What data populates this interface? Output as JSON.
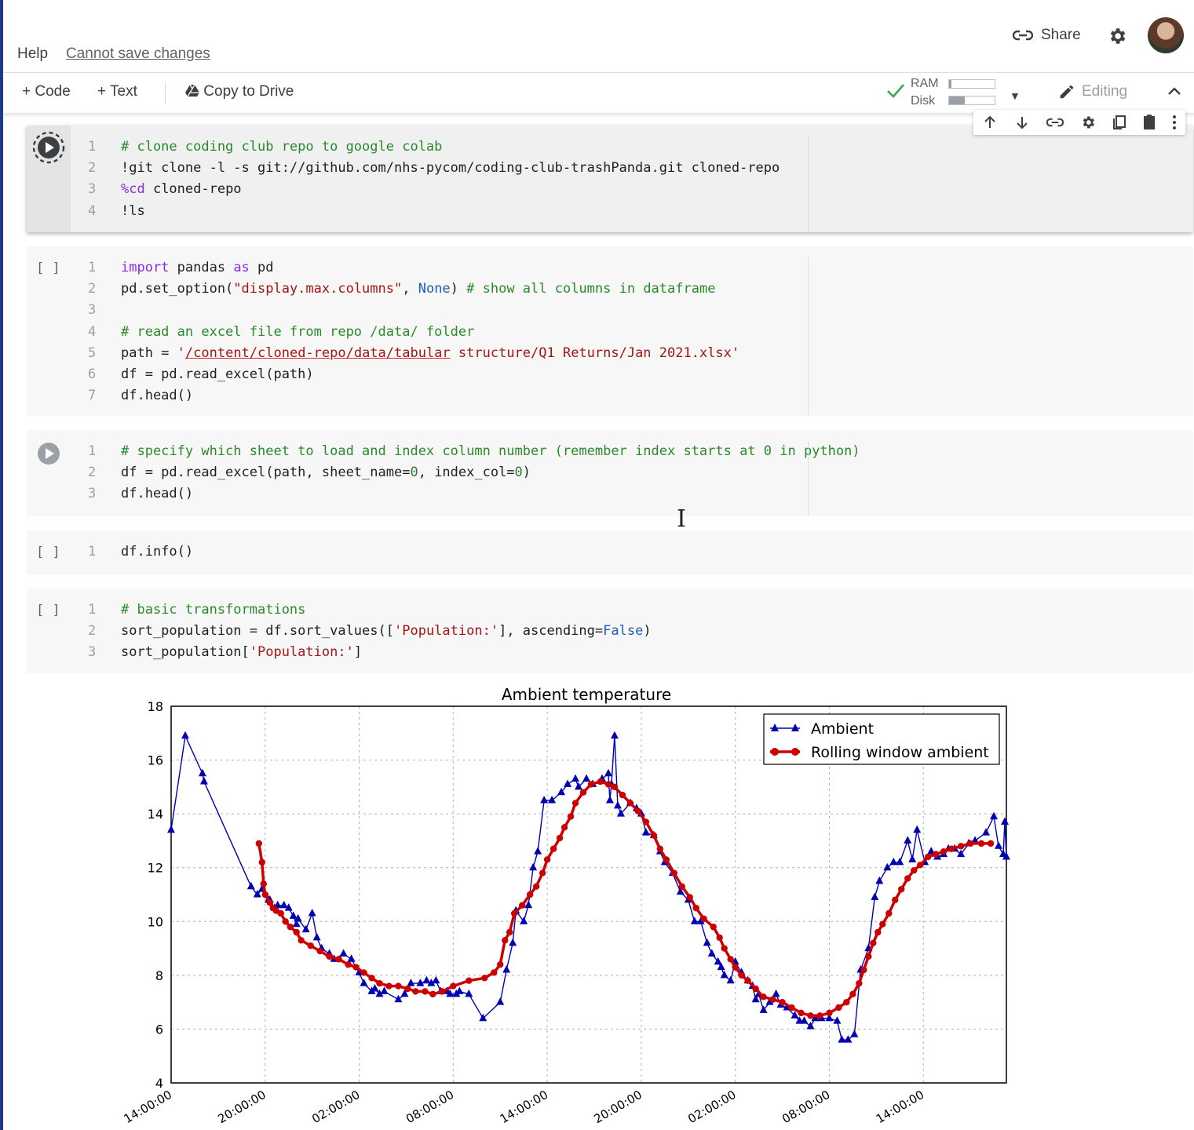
{
  "menu": {
    "help": "Help",
    "save_status": "Cannot save changes"
  },
  "header": {
    "share_label": "Share"
  },
  "toolbar": {
    "code_label": "Code",
    "text_label": "Text",
    "copy_label": "Copy to Drive",
    "ram_label": "RAM",
    "disk_label": "Disk",
    "ram_usage": 0.05,
    "disk_usage": 0.35,
    "editing_label": "Editing"
  },
  "cell_toolbar": {
    "icons": [
      "arrow-up-icon",
      "arrow-down-icon",
      "link-icon",
      "gear-icon",
      "mirror-cell-icon",
      "delete-icon",
      "more-icon"
    ]
  },
  "cells": [
    {
      "run_state": "running",
      "lines": [
        [
          [
            "cm",
            "# clone coding club repo to google colab"
          ]
        ],
        [
          [
            "pl",
            "!git clone -l -s git://github.com/nhs-pycom/coding-club-trashPanda.git cloned-repo"
          ]
        ],
        [
          [
            "mg",
            "%cd"
          ],
          [
            "pl",
            " cloned-repo"
          ]
        ],
        [
          [
            "pl",
            "!ls"
          ]
        ]
      ]
    },
    {
      "run_state": "idle",
      "bracket": "[ ]",
      "lines": [
        [
          [
            "kw",
            "import"
          ],
          [
            "pl",
            " pandas "
          ],
          [
            "kw",
            "as"
          ],
          [
            "pl",
            " pd"
          ]
        ],
        [
          [
            "pl",
            "pd.set_option("
          ],
          [
            "st",
            "\"display.max.columns\""
          ],
          [
            "pl",
            ", "
          ],
          [
            "bi",
            "None"
          ],
          [
            "pl",
            ") "
          ],
          [
            "cm",
            "# show all columns in dataframe"
          ]
        ],
        [
          [
            "pl",
            ""
          ]
        ],
        [
          [
            "cm",
            "# read an excel file from repo /data/ folder"
          ]
        ],
        [
          [
            "pl",
            "path = "
          ],
          [
            "st",
            "'"
          ],
          [
            "stl",
            "/content/cloned-repo/data/tabular"
          ],
          [
            "st",
            " structure/Q1 Returns/Jan 2021.xlsx'"
          ]
        ],
        [
          [
            "pl",
            "df = pd.read_excel(path)"
          ]
        ],
        [
          [
            "pl",
            "df.head()"
          ]
        ]
      ]
    },
    {
      "run_state": "play",
      "lines": [
        [
          [
            "cm",
            "# specify which sheet to load and index column number (remember index starts at 0 in python)"
          ]
        ],
        [
          [
            "pl",
            "df = pd.read_excel(path, sheet_name="
          ],
          [
            "nm",
            "0"
          ],
          [
            "pl",
            ", index_col="
          ],
          [
            "nm",
            "0"
          ],
          [
            "pl",
            ")"
          ]
        ],
        [
          [
            "pl",
            "df.head()"
          ]
        ]
      ]
    },
    {
      "run_state": "idle",
      "bracket": "[ ]",
      "lines": [
        [
          [
            "pl",
            "df.info()"
          ]
        ]
      ]
    },
    {
      "run_state": "idle",
      "bracket": "[ ]",
      "lines": [
        [
          [
            "cm",
            "# basic transformations"
          ]
        ],
        [
          [
            "pl",
            "sort_population = df.sort_values(["
          ],
          [
            "st",
            "'Population:'"
          ],
          [
            "pl",
            "], ascending="
          ],
          [
            "bi",
            "False"
          ],
          [
            "pl",
            ")"
          ]
        ],
        [
          [
            "pl",
            "sort_population["
          ],
          [
            "st",
            "'Population:'"
          ],
          [
            "pl",
            "]"
          ]
        ]
      ]
    }
  ],
  "chart_data": {
    "type": "line",
    "title": "Ambient temperature",
    "xlim": [
      0,
      53.3
    ],
    "ylim": [
      4,
      18
    ],
    "x_ticks": [
      {
        "x": 0,
        "label": "14:00:00"
      },
      {
        "x": 6,
        "label": "20:00:00"
      },
      {
        "x": 12,
        "label": "02:00:00"
      },
      {
        "x": 18,
        "label": "08:00:00"
      },
      {
        "x": 24,
        "label": "14:00:00"
      },
      {
        "x": 30,
        "label": "20:00:00"
      },
      {
        "x": 36,
        "label": "02:00:00"
      },
      {
        "x": 42,
        "label": "08:00:00"
      },
      {
        "x": 48,
        "label": "14:00:00"
      }
    ],
    "y_ticks": [
      4,
      6,
      8,
      10,
      12,
      14,
      16,
      18
    ],
    "grid": true,
    "legend_position": "top-right",
    "series": [
      {
        "name": "Ambient",
        "color": "#0000b3",
        "marker": "triangle",
        "points": [
          [
            0,
            13.4
          ],
          [
            0.9,
            16.9
          ],
          [
            2,
            15.5
          ],
          [
            2.1,
            15.2
          ],
          [
            5.1,
            11.3
          ],
          [
            5.5,
            11.0
          ],
          [
            5.8,
            11.2
          ],
          [
            6.2,
            10.8
          ],
          [
            6.3,
            10.8
          ],
          [
            6.6,
            10.5
          ],
          [
            6.8,
            10.6
          ],
          [
            7.2,
            10.6
          ],
          [
            7.5,
            10.5
          ],
          [
            7.8,
            10.2
          ],
          [
            8.0,
            9.9
          ],
          [
            8.1,
            10.1
          ],
          [
            8.6,
            9.7
          ],
          [
            9.0,
            10.3
          ],
          [
            9.3,
            9.4
          ],
          [
            9.6,
            9.0
          ],
          [
            10.1,
            8.8
          ],
          [
            10.4,
            8.6
          ],
          [
            11.0,
            8.8
          ],
          [
            11.5,
            8.6
          ],
          [
            12.0,
            8.1
          ],
          [
            12.3,
            7.7
          ],
          [
            12.8,
            7.4
          ],
          [
            13.0,
            7.5
          ],
          [
            13.3,
            7.3
          ],
          [
            13.6,
            7.4
          ],
          [
            14.5,
            7.1
          ],
          [
            14.9,
            7.3
          ],
          [
            15.3,
            7.7
          ],
          [
            15.9,
            7.7
          ],
          [
            16.3,
            7.8
          ],
          [
            16.6,
            7.7
          ],
          [
            16.9,
            7.8
          ],
          [
            17.2,
            7.4
          ],
          [
            17.6,
            7.4
          ],
          [
            17.8,
            7.3
          ],
          [
            18.2,
            7.3
          ],
          [
            18.4,
            7.4
          ],
          [
            19.0,
            7.3
          ],
          [
            19.9,
            6.4
          ],
          [
            21.0,
            7.0
          ],
          [
            21.4,
            8.2
          ],
          [
            21.8,
            9.2
          ],
          [
            22.0,
            10.4
          ],
          [
            22.5,
            10.0
          ],
          [
            22.8,
            10.6
          ],
          [
            23.1,
            12.0
          ],
          [
            23.4,
            12.6
          ],
          [
            23.8,
            14.5
          ],
          [
            24.3,
            14.5
          ],
          [
            24.9,
            14.8
          ],
          [
            25.3,
            15.1
          ],
          [
            25.8,
            15.3
          ],
          [
            26.0,
            15.0
          ],
          [
            26.5,
            15.3
          ],
          [
            26.9,
            15.1
          ],
          [
            27.5,
            15.3
          ],
          [
            27.9,
            15.5
          ],
          [
            28.0,
            14.5
          ],
          [
            28.1,
            15.1
          ],
          [
            28.3,
            16.9
          ],
          [
            28.5,
            14.3
          ],
          [
            28.7,
            14.0
          ],
          [
            29.3,
            14.4
          ],
          [
            29.7,
            14.2
          ],
          [
            30.0,
            14.0
          ],
          [
            30.3,
            13.3
          ],
          [
            30.8,
            13.2
          ],
          [
            31.2,
            12.6
          ],
          [
            31.5,
            12.2
          ],
          [
            32.0,
            11.8
          ],
          [
            32.5,
            11.1
          ],
          [
            33.0,
            10.8
          ],
          [
            33.4,
            10.0
          ],
          [
            33.8,
            10.0
          ],
          [
            34.2,
            9.2
          ],
          [
            34.5,
            8.8
          ],
          [
            34.9,
            8.5
          ],
          [
            35.1,
            8.3
          ],
          [
            35.3,
            8.0
          ],
          [
            35.7,
            7.8
          ],
          [
            36.0,
            8.5
          ],
          [
            36.4,
            8.1
          ],
          [
            36.8,
            7.8
          ],
          [
            37.1,
            7.6
          ],
          [
            37.3,
            7.1
          ],
          [
            37.5,
            7.3
          ],
          [
            37.8,
            6.7
          ],
          [
            38.2,
            7.0
          ],
          [
            38.6,
            7.3
          ],
          [
            38.9,
            6.9
          ],
          [
            39.3,
            6.8
          ],
          [
            39.8,
            6.5
          ],
          [
            40.1,
            6.3
          ],
          [
            40.4,
            6.3
          ],
          [
            40.8,
            6.1
          ],
          [
            41.1,
            6.4
          ],
          [
            41.5,
            6.4
          ],
          [
            42.0,
            6.4
          ],
          [
            42.5,
            6.3
          ],
          [
            42.8,
            5.6
          ],
          [
            43.2,
            5.6
          ],
          [
            43.6,
            5.8
          ],
          [
            44.0,
            8.2
          ],
          [
            44.5,
            9.0
          ],
          [
            44.9,
            10.9
          ],
          [
            45.2,
            11.5
          ],
          [
            45.7,
            12.0
          ],
          [
            46.1,
            12.2
          ],
          [
            46.5,
            12.2
          ],
          [
            47.0,
            13.0
          ],
          [
            47.3,
            12.3
          ],
          [
            47.6,
            13.4
          ],
          [
            48.1,
            12.2
          ],
          [
            48.5,
            12.6
          ],
          [
            48.9,
            12.4
          ],
          [
            49.3,
            12.5
          ],
          [
            49.6,
            12.7
          ],
          [
            50.0,
            12.7
          ],
          [
            50.4,
            12.5
          ],
          [
            50.9,
            12.9
          ],
          [
            51.3,
            13.0
          ],
          [
            52.0,
            13.3
          ],
          [
            52.5,
            13.9
          ],
          [
            52.8,
            12.8
          ],
          [
            53.1,
            12.5
          ],
          [
            53.2,
            13.7
          ],
          [
            53.3,
            12.4
          ]
        ]
      },
      {
        "name": "Rolling window ambient",
        "color": "#cc0000",
        "marker": "circle",
        "points": [
          [
            5.6,
            12.9
          ],
          [
            5.8,
            12.2
          ],
          [
            5.9,
            11.4
          ],
          [
            6.0,
            11.0
          ],
          [
            6.3,
            10.7
          ],
          [
            6.5,
            10.5
          ],
          [
            6.7,
            10.4
          ],
          [
            7.0,
            10.3
          ],
          [
            7.3,
            10.0
          ],
          [
            7.6,
            9.8
          ],
          [
            8.0,
            9.6
          ],
          [
            8.3,
            9.3
          ],
          [
            8.9,
            9.1
          ],
          [
            9.5,
            8.9
          ],
          [
            10.1,
            8.7
          ],
          [
            10.7,
            8.6
          ],
          [
            11.3,
            8.4
          ],
          [
            11.8,
            8.3
          ],
          [
            12.3,
            8.1
          ],
          [
            12.8,
            7.9
          ],
          [
            13.3,
            7.7
          ],
          [
            13.9,
            7.6
          ],
          [
            14.5,
            7.6
          ],
          [
            15.1,
            7.5
          ],
          [
            15.6,
            7.4
          ],
          [
            16.2,
            7.4
          ],
          [
            16.7,
            7.3
          ],
          [
            17.3,
            7.4
          ],
          [
            18.0,
            7.6
          ],
          [
            19.0,
            7.8
          ],
          [
            20.0,
            7.9
          ],
          [
            20.6,
            8.1
          ],
          [
            21.0,
            8.4
          ],
          [
            21.3,
            9.3
          ],
          [
            21.6,
            9.6
          ],
          [
            21.9,
            10.3
          ],
          [
            22.4,
            10.6
          ],
          [
            22.9,
            11.0
          ],
          [
            23.3,
            11.3
          ],
          [
            23.7,
            11.8
          ],
          [
            24.0,
            12.3
          ],
          [
            24.4,
            12.7
          ],
          [
            24.8,
            13.1
          ],
          [
            25.1,
            13.5
          ],
          [
            25.5,
            13.9
          ],
          [
            25.8,
            14.4
          ],
          [
            26.3,
            14.8
          ],
          [
            26.8,
            15.1
          ],
          [
            27.4,
            15.2
          ],
          [
            27.9,
            15.1
          ],
          [
            28.3,
            15.0
          ],
          [
            28.8,
            14.7
          ],
          [
            29.3,
            14.4
          ],
          [
            29.8,
            14.1
          ],
          [
            30.3,
            13.7
          ],
          [
            30.8,
            13.2
          ],
          [
            31.2,
            12.7
          ],
          [
            31.6,
            12.3
          ],
          [
            32.1,
            11.8
          ],
          [
            32.6,
            11.3
          ],
          [
            33.1,
            10.9
          ],
          [
            33.5,
            10.5
          ],
          [
            34.0,
            10.1
          ],
          [
            34.6,
            9.8
          ],
          [
            35.0,
            9.4
          ],
          [
            35.3,
            9.0
          ],
          [
            35.7,
            8.6
          ],
          [
            36.0,
            8.3
          ],
          [
            36.4,
            8.0
          ],
          [
            36.8,
            7.8
          ],
          [
            37.3,
            7.5
          ],
          [
            37.8,
            7.2
          ],
          [
            38.4,
            7.1
          ],
          [
            39.0,
            7.0
          ],
          [
            39.6,
            6.8
          ],
          [
            40.2,
            6.6
          ],
          [
            40.8,
            6.5
          ],
          [
            41.4,
            6.5
          ],
          [
            42.0,
            6.6
          ],
          [
            42.6,
            6.8
          ],
          [
            43.1,
            7.0
          ],
          [
            43.5,
            7.3
          ],
          [
            43.9,
            7.7
          ],
          [
            44.2,
            8.2
          ],
          [
            44.5,
            8.7
          ],
          [
            44.8,
            9.2
          ],
          [
            45.1,
            9.6
          ],
          [
            45.4,
            9.9
          ],
          [
            45.8,
            10.3
          ],
          [
            46.2,
            10.8
          ],
          [
            46.6,
            11.2
          ],
          [
            47.0,
            11.6
          ],
          [
            47.4,
            11.9
          ],
          [
            47.8,
            12.1
          ],
          [
            48.3,
            12.4
          ],
          [
            48.8,
            12.5
          ],
          [
            49.3,
            12.6
          ],
          [
            49.8,
            12.7
          ],
          [
            50.4,
            12.8
          ],
          [
            51.0,
            12.9
          ],
          [
            51.7,
            12.9
          ],
          [
            52.3,
            12.9
          ]
        ]
      }
    ]
  }
}
